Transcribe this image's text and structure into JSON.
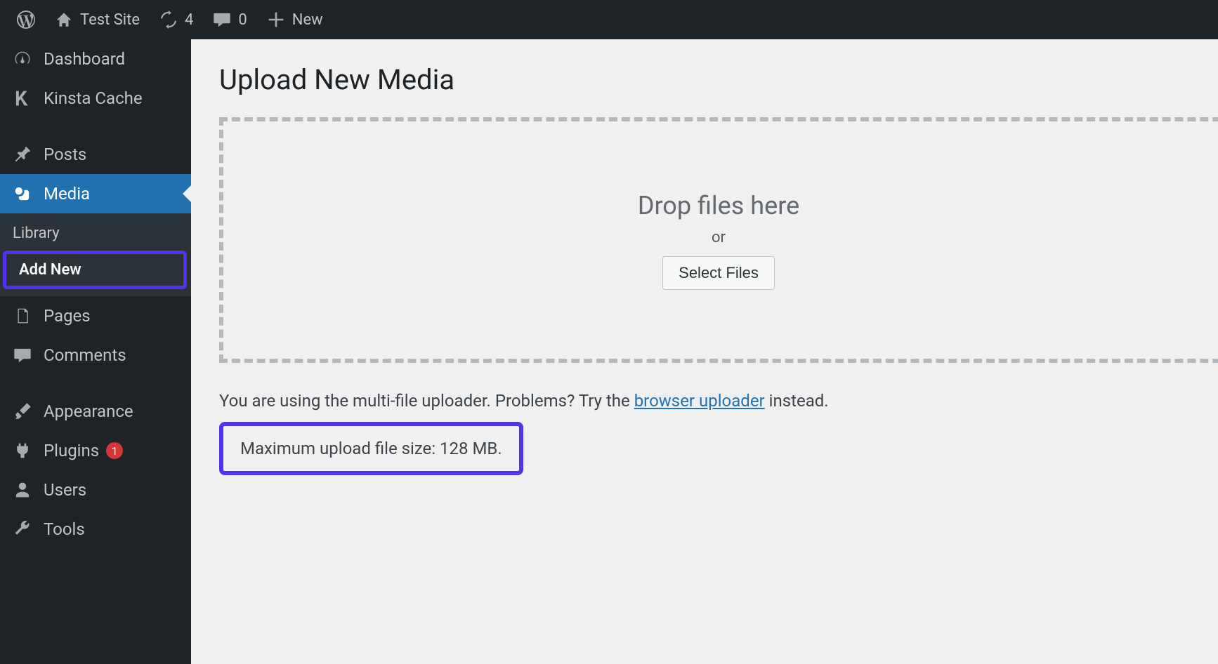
{
  "adminbar": {
    "site_name": "Test Site",
    "updates_count": "4",
    "comments_count": "0",
    "new_label": "New"
  },
  "sidebar": {
    "dashboard": "Dashboard",
    "kinsta": "Kinsta Cache",
    "posts": "Posts",
    "media": "Media",
    "media_sub": {
      "library": "Library",
      "add_new": "Add New"
    },
    "pages": "Pages",
    "comments": "Comments",
    "appearance": "Appearance",
    "plugins": "Plugins",
    "plugins_count": "1",
    "users": "Users",
    "tools": "Tools"
  },
  "main": {
    "title": "Upload New Media",
    "drop_text": "Drop files here",
    "or_text": "or",
    "select_btn": "Select Files",
    "info_before": "You are using the multi-file uploader. Problems? Try the ",
    "info_link": "browser uploader",
    "info_after": " instead.",
    "max_size": "Maximum upload file size: 128 MB."
  }
}
